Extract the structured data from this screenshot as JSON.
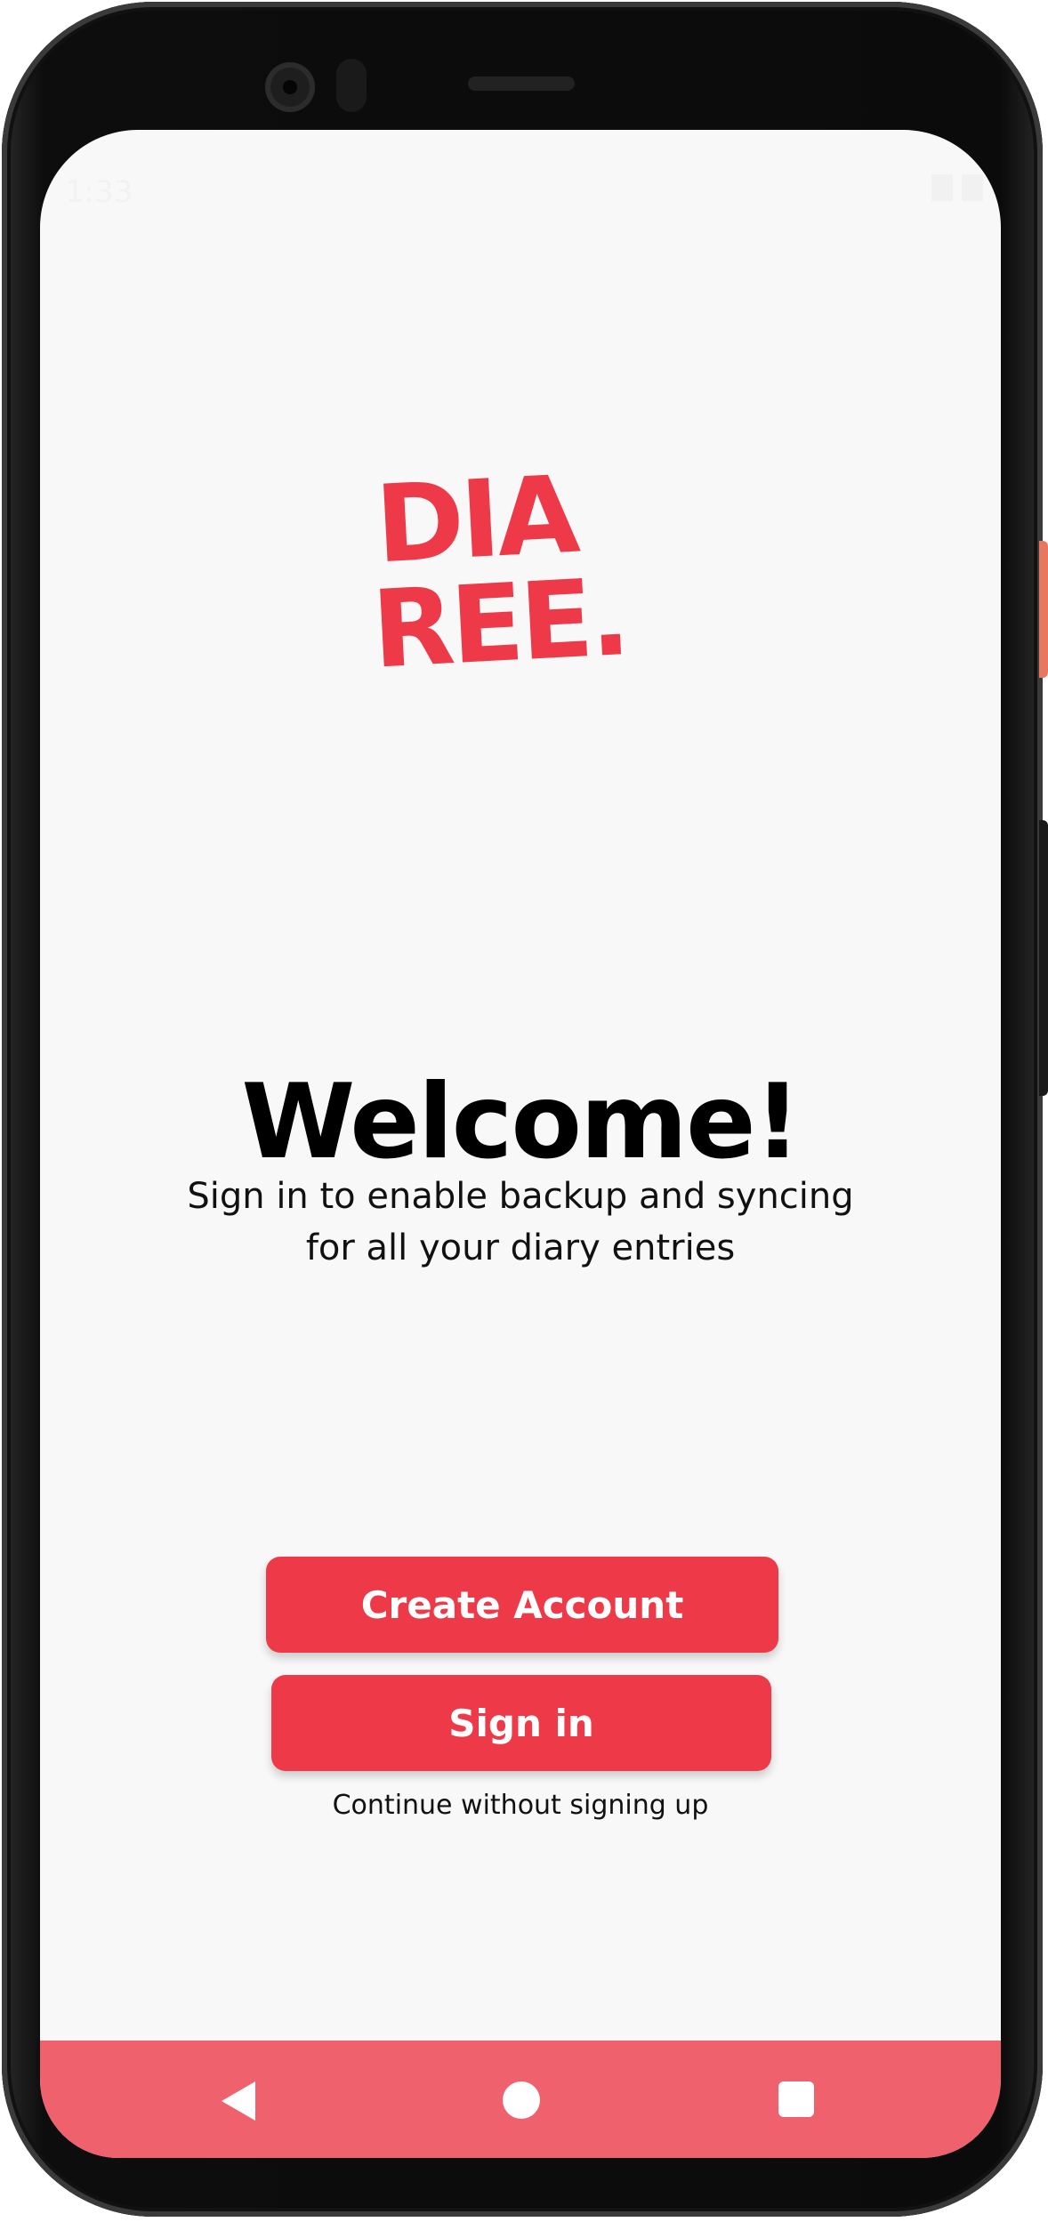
{
  "status_bar": {
    "time": "1:33"
  },
  "logo": {
    "line1": "DIA",
    "line2": "REE.",
    "color": "#ee3a48"
  },
  "welcome": {
    "title": "Welcome!",
    "subtitle_line1": "Sign in to enable backup and syncing",
    "subtitle_line2": "for all your diary entries"
  },
  "actions": {
    "create_account_label": "Create Account",
    "sign_in_label": "Sign in",
    "continue_label": "Continue without signing up"
  },
  "nav_bar": {
    "icons": [
      "back-icon",
      "home-icon",
      "recents-icon"
    ],
    "color": "#f0616e"
  },
  "colors": {
    "accent": "#ee3a48",
    "background": "#f8f8f8"
  }
}
